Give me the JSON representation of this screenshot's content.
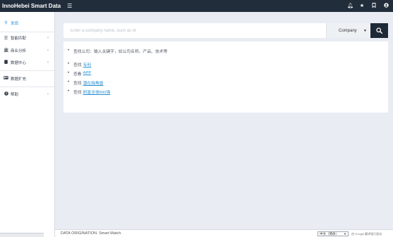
{
  "header": {
    "brand": "InnoHebei Smart Data",
    "menu_icon": "hamburger-icon",
    "icons": [
      "bell-icon",
      "star-icon",
      "bookmark-icon",
      "user-icon"
    ]
  },
  "sidebar": {
    "items": [
      {
        "label": "发现",
        "icon": "search-icon",
        "active": true
      },
      {
        "label": "智能匹配",
        "icon": "list-icon",
        "has_chevron": true
      },
      {
        "label": "商业分析",
        "icon": "bank-icon",
        "has_chevron": true
      },
      {
        "label": "数据中心",
        "icon": "database-icon",
        "has_chevron": true
      },
      {
        "label": "数据扩充",
        "icon": "id-card-icon"
      },
      {
        "label": "帮助",
        "icon": "question-icon",
        "has_chevron": true
      }
    ]
  },
  "search": {
    "placeholder": "Enter a company name, such as M",
    "type_label": "Company"
  },
  "panel": {
    "intro": "查找公司：输入关键字，如公司名称、产品、技术等",
    "links": [
      {
        "prefix": "查找",
        "link": "专利"
      },
      {
        "prefix": "查看",
        "link": "APP"
      },
      {
        "prefix": "查找",
        "link": "潜在独角兽"
      },
      {
        "prefix": "查找",
        "link": "财富全球500强"
      }
    ]
  },
  "footer": {
    "text": "DATA ORIGINATION. Smart Match.",
    "lang_selected": "中文（简体）",
    "google_translate": "由 Google 翻译强力驱动"
  },
  "colors": {
    "topbar": "#222d3b",
    "accent": "#2a8fd4",
    "search_button": "#1f2a38",
    "background": "#e9edf3"
  }
}
